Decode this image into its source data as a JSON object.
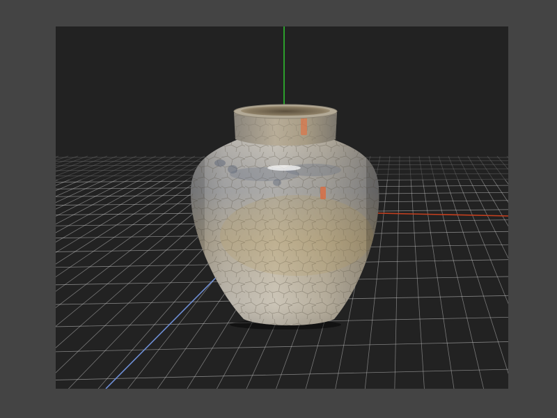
{
  "app": {
    "frame_color": "#444444",
    "viewport_background": "#222222"
  },
  "scene": {
    "object": "ceramic-vase",
    "object_finish": "crackle-glaze",
    "grid_line_color": "#cfcfcf",
    "axes": {
      "x": {
        "color": "#c8401e"
      },
      "y": {
        "color": "#2fc12f"
      },
      "z": {
        "color": "#6f8fd6"
      }
    }
  }
}
